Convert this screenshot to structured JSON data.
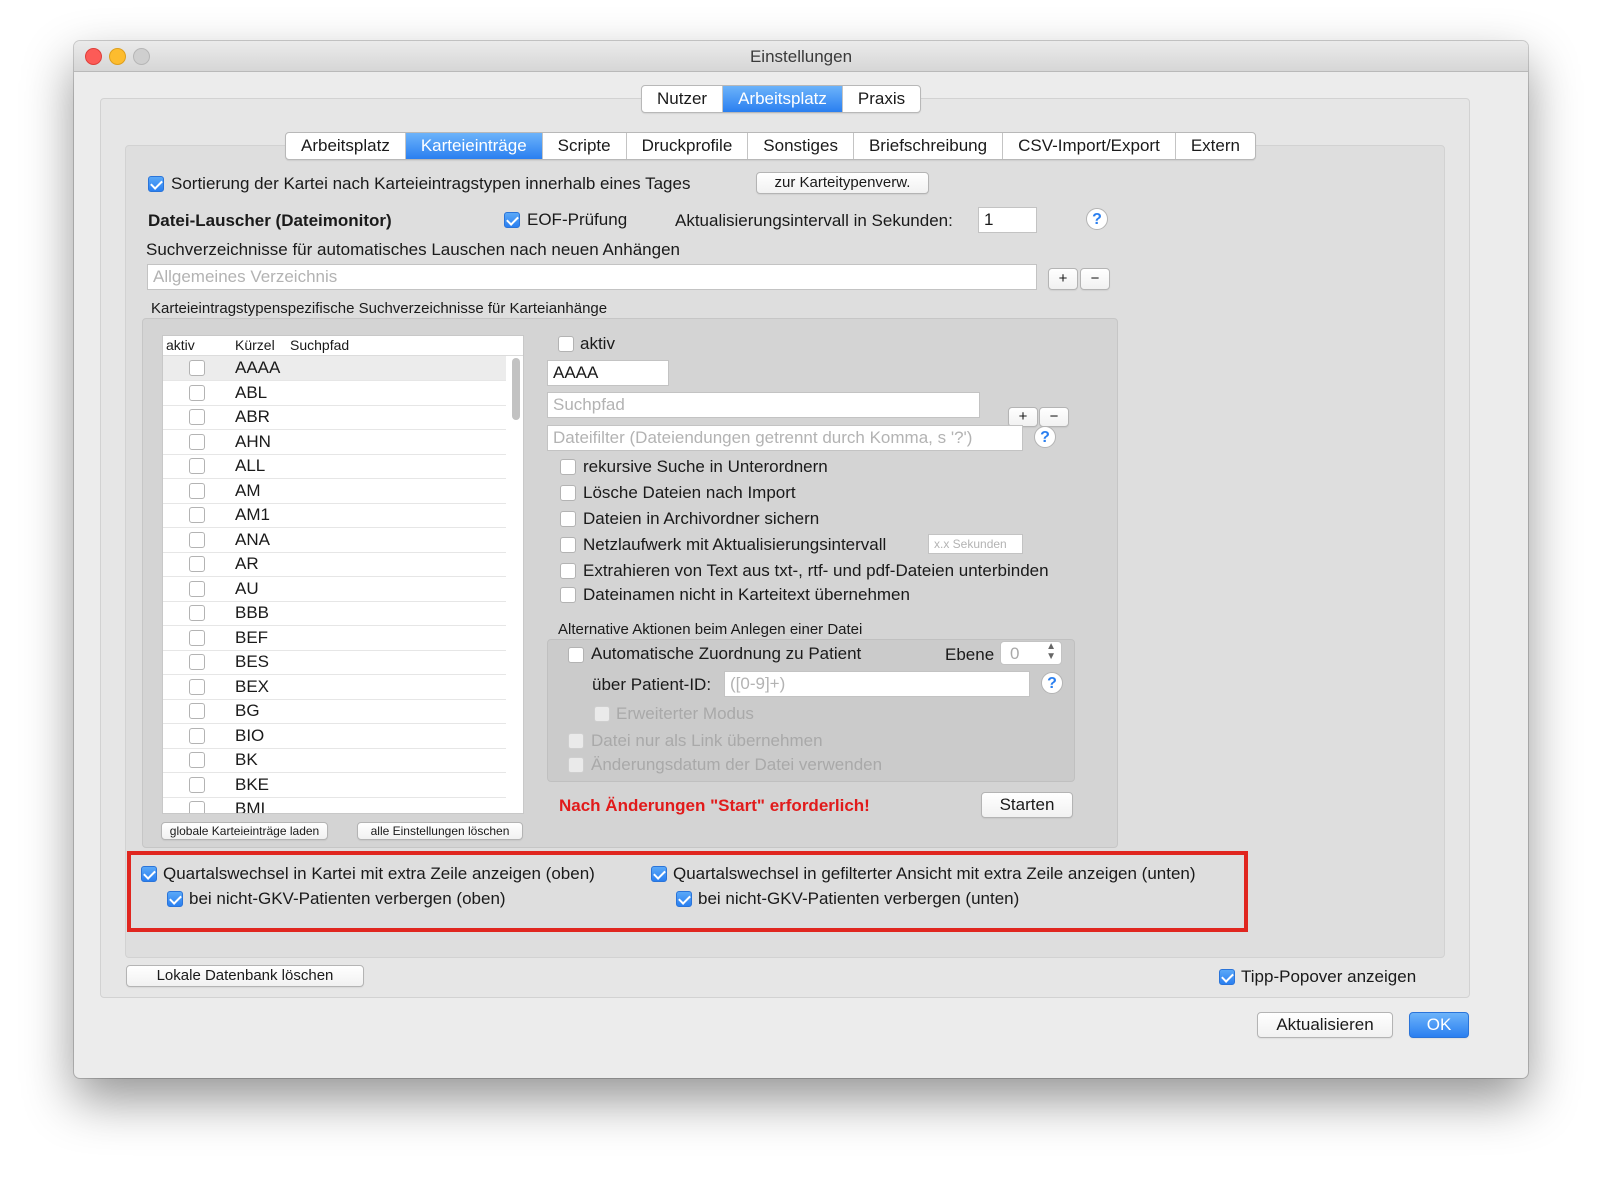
{
  "window": {
    "title": "Einstellungen"
  },
  "top_tabs": [
    {
      "label": "Nutzer",
      "active": false
    },
    {
      "label": "Arbeitsplatz",
      "active": true
    },
    {
      "label": "Praxis",
      "active": false
    }
  ],
  "sub_tabs": [
    {
      "label": "Arbeitsplatz",
      "active": false
    },
    {
      "label": "Karteieinträge",
      "active": true
    },
    {
      "label": "Scripte",
      "active": false
    },
    {
      "label": "Druckprofile",
      "active": false
    },
    {
      "label": "Sonstiges",
      "active": false
    },
    {
      "label": "Briefschreibung",
      "active": false
    },
    {
      "label": "CSV-Import/Export",
      "active": false
    },
    {
      "label": "Extern",
      "active": false
    }
  ],
  "sort": {
    "label": "Sortierung der Kartei nach Karteieintragstypen innerhalb eines Tages",
    "checked": true,
    "button": "zur Karteitypenverw."
  },
  "monitor": {
    "heading": "Datei-Lauscher (Dateimonitor)",
    "eof_label": "EOF-Prüfung",
    "eof_checked": true,
    "interval_label": "Aktualisierungsintervall in Sekunden:",
    "interval_value": "1",
    "help": "?"
  },
  "dirs": {
    "label": "Suchverzeichnisse für automatisches Lauschen nach neuen Anhängen",
    "placeholder": "Allgemeines Verzeichnis",
    "add": "+",
    "remove": "−"
  },
  "type_dirs": {
    "label": "Karteieintragstypenspezifische Suchverzeichnisse für Karteianhänge",
    "columns": [
      "aktiv",
      "Kürzel",
      "Suchpfad"
    ],
    "rows": [
      "AAAA",
      "ABL",
      "ABR",
      "AHN",
      "ALL",
      "AM",
      "AM1",
      "ANA",
      "AR",
      "AU",
      "BBB",
      "BEF",
      "BES",
      "BEX",
      "BG",
      "BIO",
      "BK",
      "BKE",
      "BMI"
    ],
    "load_button": "globale Karteieinträge laden",
    "clear_button": "alle Einstellungen löschen"
  },
  "detail": {
    "aktiv_label": "aktiv",
    "code_value": "AAAA",
    "path_placeholder": "Suchpfad",
    "filter_placeholder": "Dateifilter (Dateiendungen getrennt durch Komma, s '?')",
    "add": "+",
    "remove": "−",
    "help": "?",
    "options": [
      "rekursive Suche in Unterordnern",
      "Lösche Dateien nach Import",
      "Dateien in Archivordner sichern",
      "Netzlaufwerk mit Aktualisierungsintervall",
      "Extrahieren von Text aus txt-, rtf- und pdf-Dateien unterbinden",
      "Dateinamen nicht in Karteitext übernehmen"
    ],
    "seconds_placeholder": "x.x Sekunden",
    "alt_label": "Alternative Aktionen beim Anlegen einer Datei",
    "auto_assign": "Automatische Zuordnung zu Patient",
    "level_label": "Ebene",
    "level_value": "0",
    "patient_id_label": "über Patient-ID:",
    "patient_id_placeholder": "([0-9]+)",
    "extended_mode": "Erweiterter Modus",
    "link_only": "Datei nur als Link übernehmen",
    "use_mod_date": "Änderungsdatum der Datei verwenden",
    "warning": "Nach Änderungen \"Start\" erforderlich!",
    "start_button": "Starten"
  },
  "quarter": {
    "top_label": "Quartalswechsel in Kartei mit extra Zeile anzeigen (oben)",
    "top_sub": "bei nicht-GKV-Patienten verbergen (oben)",
    "bottom_label": "Quartalswechsel in gefilterter Ansicht mit extra Zeile anzeigen (unten)",
    "bottom_sub": "bei nicht-GKV-Patienten verbergen (unten)"
  },
  "footer": {
    "delete_db": "Lokale Datenbank löschen",
    "tips_label": "Tipp-Popover anzeigen",
    "tips_checked": true,
    "refresh": "Aktualisieren",
    "ok": "OK"
  },
  "colors": {
    "accent": "#2a7ff0",
    "highlight_box": "#e0261f",
    "warning_text": "#e11b1b"
  }
}
